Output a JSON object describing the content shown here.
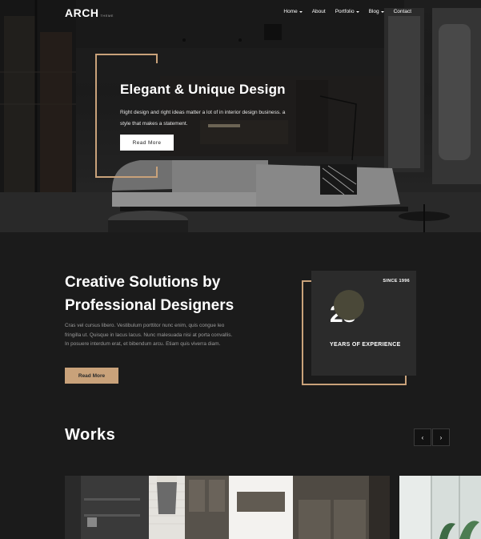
{
  "brand": {
    "logo": "ARCH",
    "logo_sub": "THEME"
  },
  "nav": {
    "items": [
      {
        "label": "Home",
        "has_dropdown": true
      },
      {
        "label": "About",
        "has_dropdown": false
      },
      {
        "label": "Portfolio",
        "has_dropdown": true
      },
      {
        "label": "Blog",
        "has_dropdown": true
      },
      {
        "label": "Contact",
        "has_dropdown": false
      }
    ]
  },
  "hero": {
    "title": "Elegant & Unique Design",
    "text": "Right design and right ideas matter a lot of in interior design business. a style that makes a statement.",
    "button_label": "Read More"
  },
  "about": {
    "title_line1": "Creative Solutions by",
    "title_line2": "Professional Designers",
    "text": "Cras vel cursus libero. Vestibulum porttitor nunc enim, quis congue leo fringilla ut. Quisque in lacus lacus. Nunc malesuada nisi at porta convallis. In posuere interdum erat, et bibendum arcu. Etiam quis viverra diam.",
    "button_label": "Read More",
    "experience": {
      "since": "SINCE 1996",
      "number": "25",
      "label": "YEARS OF EXPERIENCE"
    }
  },
  "works": {
    "title": "Works",
    "prev_icon": "‹",
    "next_icon": "›"
  },
  "colors": {
    "accent": "#c9a27a",
    "background": "#1b1b1b",
    "box": "#2b2b2b"
  }
}
